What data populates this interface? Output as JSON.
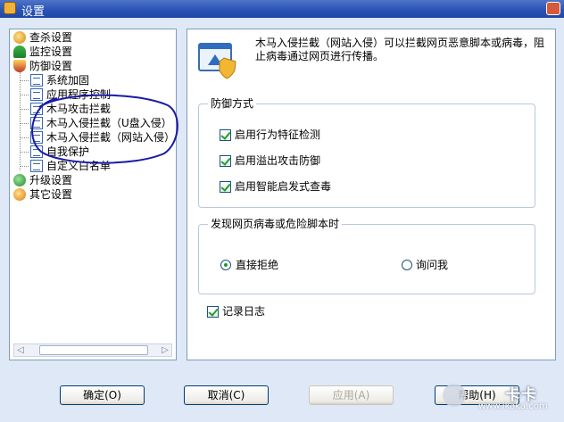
{
  "window": {
    "title": "设置"
  },
  "tree": {
    "items": [
      {
        "label": "查杀设置",
        "icon": "scan-settings-icon",
        "level": 0
      },
      {
        "label": "监控设置",
        "icon": "monitor-settings-icon",
        "level": 0
      },
      {
        "label": "防御设置",
        "icon": "defense-settings-icon",
        "level": 0
      },
      {
        "label": "系统加固",
        "icon": "document-icon",
        "level": 1
      },
      {
        "label": "应用程序控制",
        "icon": "document-icon",
        "level": 1
      },
      {
        "label": "木马攻击拦截",
        "icon": "document-icon",
        "level": 1
      },
      {
        "label": "木马入侵拦截（U盘入侵）",
        "icon": "document-icon",
        "level": 1
      },
      {
        "label": "木马入侵拦截（网站入侵）",
        "icon": "document-icon",
        "level": 1,
        "selected": true
      },
      {
        "label": "自我保护",
        "icon": "document-icon",
        "level": 1
      },
      {
        "label": "自定义白名单",
        "icon": "document-icon",
        "level": 1
      },
      {
        "label": "升级设置",
        "icon": "upgrade-settings-icon",
        "level": 0
      },
      {
        "label": "其它设置",
        "icon": "other-settings-icon",
        "level": 0
      }
    ]
  },
  "panel": {
    "description": "木马入侵拦截（网站入侵）可以拦截网页恶意脚本或病毒，阻止病毒通过网页进行传播。",
    "defense": {
      "legend": "防御方式",
      "options": [
        {
          "label": "启用行为特征检测",
          "checked": true
        },
        {
          "label": "启用溢出攻击防御",
          "checked": true
        },
        {
          "label": "启用智能启发式查毒",
          "checked": true
        }
      ]
    },
    "found": {
      "legend": "发现网页病毒或危险脚本时",
      "options": [
        {
          "label": "直接拒绝",
          "selected": true
        },
        {
          "label": "询问我",
          "selected": false
        }
      ]
    },
    "log": {
      "label": "记录日志",
      "checked": true
    }
  },
  "buttons": {
    "ok": "确定(O)",
    "cancel": "取消(C)",
    "apply": "应用(A)",
    "help": "帮助(H)"
  },
  "watermark": {
    "brand": "卡卡",
    "site": "www.ikaka.com"
  }
}
